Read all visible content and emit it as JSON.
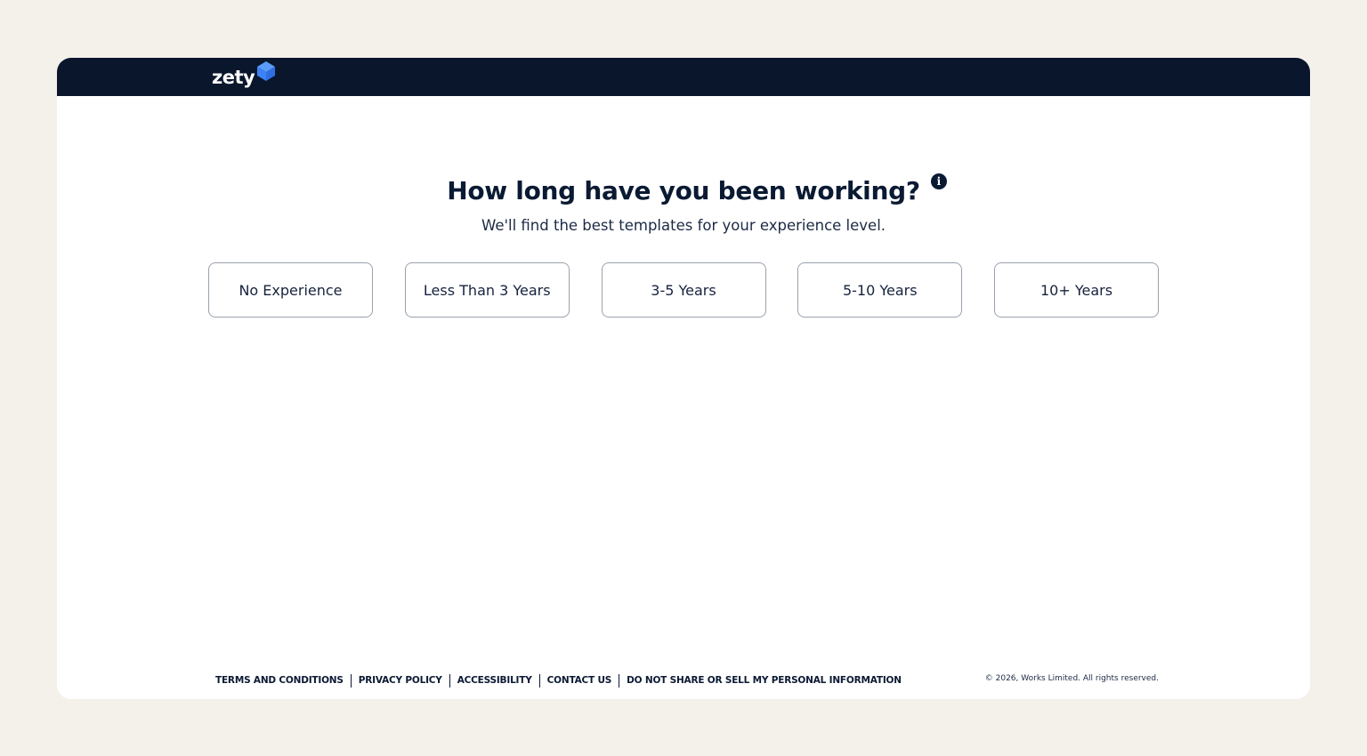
{
  "header": {
    "logo_text": "zety"
  },
  "main": {
    "title": "How long have you been working?",
    "info_icon": "i",
    "subtitle": "We'll find the best templates for your experience level.",
    "options": [
      {
        "label": "No Experience"
      },
      {
        "label": "Less Than 3 Years"
      },
      {
        "label": "3-5 Years"
      },
      {
        "label": "5-10 Years"
      },
      {
        "label": "10+ Years"
      }
    ]
  },
  "footer": {
    "links": [
      {
        "label": "TERMS AND CONDITIONS"
      },
      {
        "label": "PRIVACY POLICY"
      },
      {
        "label": "ACCESSIBILITY"
      },
      {
        "label": "CONTACT US"
      },
      {
        "label": "DO NOT SHARE OR SELL MY PERSONAL INFORMATION"
      }
    ],
    "copyright": "© 2026, Works Limited. All rights reserved."
  },
  "colors": {
    "page_background": "#f4f1eb",
    "header_background": "#0a162c",
    "text_primary": "#0b1a33",
    "logo_accent": "#3b82f6",
    "option_border": "#9aa1ad"
  },
  "icons": {
    "logo_mark": "zety-logo-mark-icon",
    "info": "info-icon"
  }
}
